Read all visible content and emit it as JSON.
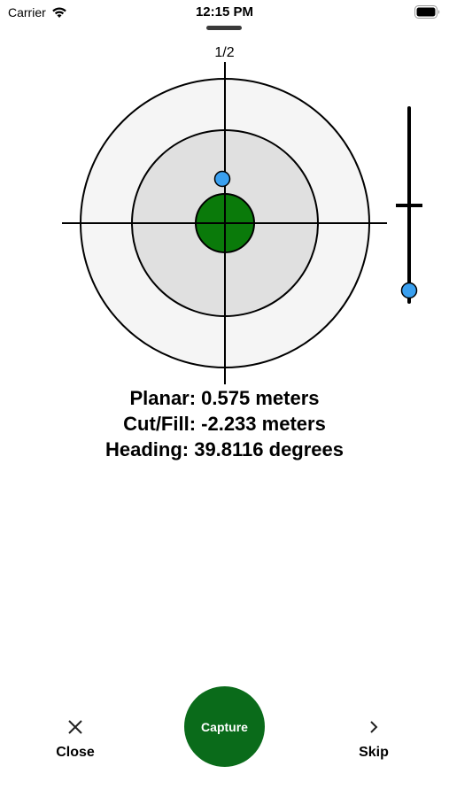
{
  "status_bar": {
    "carrier": "Carrier",
    "time": "12:15 PM",
    "icons": [
      "wifi-icon",
      "battery-icon"
    ]
  },
  "page_indicator": "1/2",
  "readouts": {
    "planar": "Planar: 0.575 meters",
    "cut_fill": "Cut/Fill: -2.233 meters",
    "heading": "Heading: 39.8116 degrees"
  },
  "colors": {
    "outer_ring": "#f5f5f5",
    "middle_ring": "#e0e0e0",
    "center_target": "#0a7a0a",
    "position_marker": "#3aa0f0",
    "capture_button": "#0a6b1a"
  },
  "toolbar": {
    "close_label": "Close",
    "close_icon": "close-icon",
    "capture_label": "Capture",
    "skip_label": "Skip",
    "skip_icon": "chevron-right-icon"
  }
}
